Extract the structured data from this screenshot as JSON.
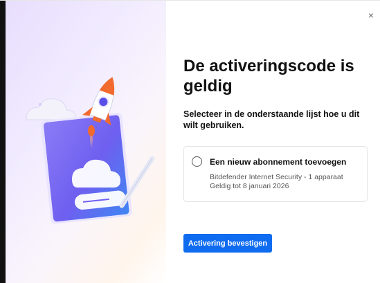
{
  "dialog": {
    "close_symbol": "×",
    "title": "De activeringscode is geldig",
    "subtitle": "Selecteer in de onderstaande lijst hoe u dit wilt gebruiken.",
    "option": {
      "label": "Een nieuw abonnement toevoegen",
      "product": "Bitdefender Internet Security - 1 apparaat",
      "validity": "Geldig tot 8 januari 2026",
      "selected": false
    },
    "confirm_button": "Activering bevestigen"
  },
  "colors": {
    "accent": "#0f6cf0",
    "rocket_flame": "#f26a2e",
    "tablet": "#7b6cf2"
  },
  "icons": [
    "close-icon",
    "radio-icon",
    "rocket-illustration-icon",
    "cloud-icon",
    "pen-icon"
  ]
}
